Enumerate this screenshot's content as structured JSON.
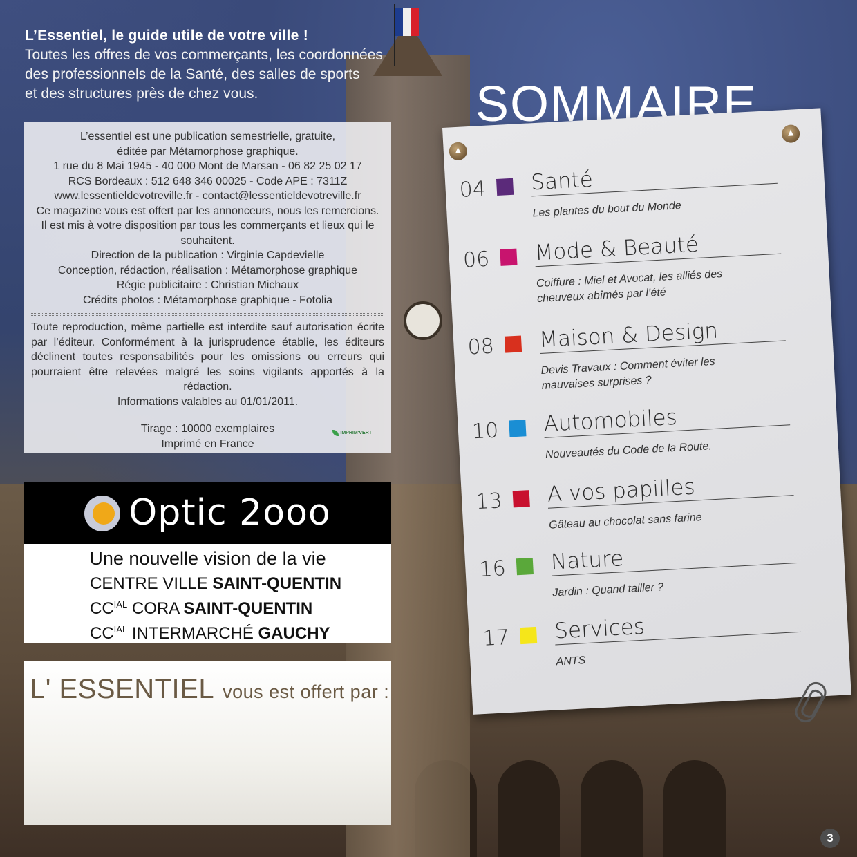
{
  "intro": {
    "title": "L’Essentiel, le guide utile de votre ville !",
    "lines": [
      "Toutes les offres de vos commerçants, les coordonnées",
      "des professionnels de la Santé, des salles de sports",
      "et des structures près de chez vous."
    ]
  },
  "colophon": {
    "block1": [
      "L’essentiel est une publication semestrielle, gratuite,",
      "éditée par Métamorphose graphique.",
      "1 rue du 8 Mai 1945 - 40 000 Mont de Marsan - 06 82 25 02 17",
      "RCS Bordeaux : 512 648 346 00025 - Code APE : 7311Z",
      "www.lessentieldevotreville.fr - contact@lessentieldevotreville.fr",
      "Ce magazine vous est offert par les annonceurs, nous les remercions.",
      "Il est mis à votre disposition par tous les commerçants et lieux qui le souhaitent.",
      "Direction de la publication : Virginie Capdevielle",
      "Conception, rédaction, réalisation : Métamorphose graphique",
      "Régie publicitaire : Christian Michaux",
      "Crédits photos : Métamorphose graphique - Fotolia"
    ],
    "block2": "Toute reproduction, même partielle est interdite sauf autorisation écrite par l’éditeur. Conformément à la jurisprudence établie, les éditeurs déclinent toutes responsabilités pour les omissions ou erreurs qui pourraient être relevées malgré les soins vigilants apportés à la rédaction.",
    "block2_last": "Informations valables au 01/01/2011.",
    "tirage": "Tirage : 10000 exemplaires",
    "imprime": "Imprimé en France",
    "imprimvert": "IMPRIM'VERT"
  },
  "optic": {
    "brand": "Optic 2ooo",
    "tagline": "Une nouvelle vision de la vie",
    "line1_a": "CENTRE VILLE ",
    "line1_b": "SAINT-QUENTIN",
    "line2_a": "CC",
    "line2_sup": "IAL",
    "line2_c": " CORA ",
    "line2_b": "SAINT-QUENTIN",
    "line3_a": "CC",
    "line3_sup": "IAL",
    "line3_c": " INTERMARCHÉ ",
    "line3_b": "GAUCHY"
  },
  "offert": {
    "big": "L' ESSENTIEL",
    "small": "vous est offert par :"
  },
  "sommaire": {
    "title": "SOMMAIRE",
    "entries": [
      {
        "num": "04",
        "title": "Santé",
        "sub": "Les plantes du bout du Monde",
        "color": "#5b2a7a"
      },
      {
        "num": "06",
        "title": "Mode & Beauté",
        "sub": "Coiffure : Miel et Avocat, les alliés des cheuveux abîmés par l’été",
        "color": "#c8146e"
      },
      {
        "num": "08",
        "title": "Maison & Design",
        "sub": "Devis Travaux : Comment éviter les mauvaises surprises ?",
        "color": "#d8301e"
      },
      {
        "num": "10",
        "title": "Automobiles",
        "sub": "Nouveautés du Code de la Route.",
        "color": "#1a8ed4"
      },
      {
        "num": "13",
        "title": "A vos papilles",
        "sub": "Gâteau au chocolat sans farine",
        "color": "#c8102e"
      },
      {
        "num": "16",
        "title": "Nature",
        "sub": "Jardin : Quand tailler ?",
        "color": "#5aa83a"
      },
      {
        "num": "17",
        "title": "Services",
        "sub": "ANTS",
        "color": "#f5e61a"
      }
    ]
  },
  "page_number": "3"
}
